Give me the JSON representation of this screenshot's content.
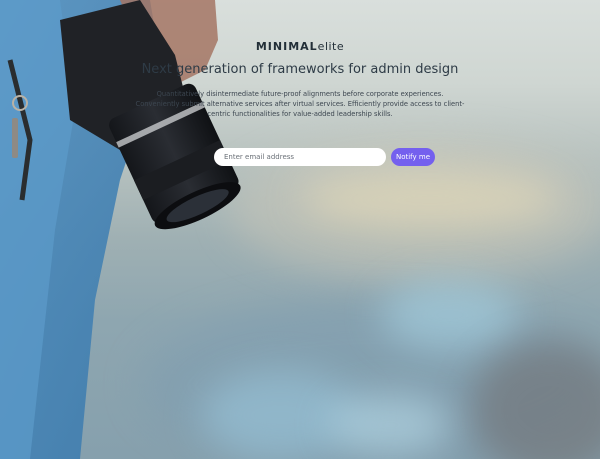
{
  "brand": {
    "bold": "MINIMAL",
    "light": "elite"
  },
  "tagline": "Next generation of frameworks for admin design",
  "description": "Quantitatively disintermediate future-proof alignments before corporate experiences. Conveniently submit alternative services after virtual services. Efficiently provide access to client-centric functionalities for value-added leadership skills.",
  "signup": {
    "email_placeholder": "Enter email address",
    "button_label": "Notify me"
  },
  "colors": {
    "accent": "#7460ee",
    "input_bg": "#ffffff"
  }
}
